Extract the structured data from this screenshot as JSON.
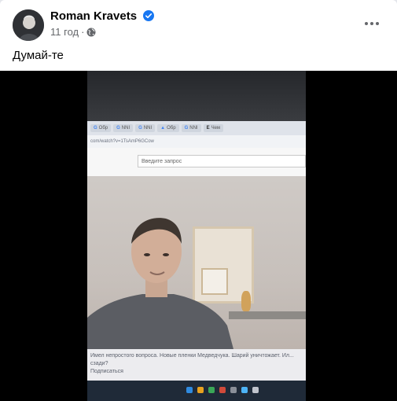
{
  "post": {
    "author": "Roman Kravets",
    "time": "11 год",
    "dot": "·",
    "text": "Думай-те"
  },
  "video": {
    "tabs": [
      "Обр",
      "NNI",
      "NNI",
      "Обр",
      "Обр",
      "NNI",
      "Чем"
    ],
    "url": "com/watch?v=1TsAmP6GCow",
    "search_placeholder": "Введите запрос",
    "caption": "Имел непростого вопроса. Новые пленки Медведчука. Шарий уничтожает. Ил... сзади?",
    "caption_sub": "Подписаться"
  },
  "colors": {
    "verified": "#1877f2",
    "video_bg": "#000000"
  }
}
